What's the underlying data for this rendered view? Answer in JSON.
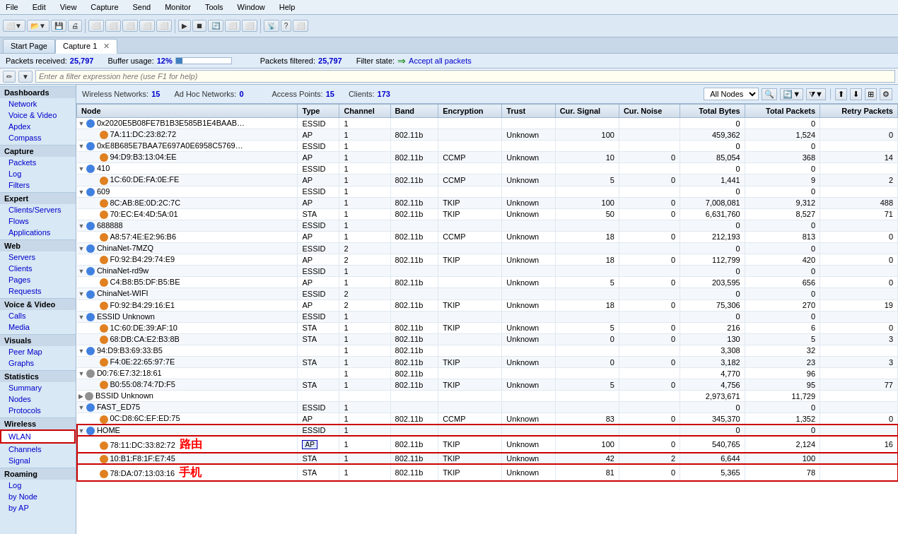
{
  "menubar": {
    "items": [
      "File",
      "Edit",
      "View",
      "Capture",
      "Send",
      "Monitor",
      "Tools",
      "Window",
      "Help"
    ]
  },
  "tabs": [
    {
      "label": "Start Page",
      "active": false
    },
    {
      "label": "Capture 1",
      "active": true,
      "closable": true
    }
  ],
  "statusbar": {
    "packets_received_label": "Packets received:",
    "packets_received_value": "25,797",
    "buffer_usage_label": "Buffer usage:",
    "buffer_usage_value": "12%",
    "packets_filtered_label": "Packets filtered:",
    "packets_filtered_value": "25,797",
    "filter_state_label": "Filter state:",
    "filter_state_value": "Accept all packets"
  },
  "filterbar": {
    "placeholder": "Enter a filter expression here (use F1 for help)"
  },
  "sidebar": {
    "sections": [
      {
        "label": "Dashboards",
        "items": [
          "Network",
          "Voice & Video",
          "Apdex",
          "Compass"
        ]
      },
      {
        "label": "Capture",
        "items": [
          "Packets",
          "Log",
          "Filters"
        ]
      },
      {
        "label": "Expert",
        "items": [
          "Clients/Servers",
          "Flows",
          "Applications"
        ]
      },
      {
        "label": "Web",
        "items": [
          "Servers",
          "Clients",
          "Pages",
          "Requests"
        ]
      },
      {
        "label": "Voice & Video",
        "items": [
          "Calls",
          "Media"
        ]
      },
      {
        "label": "Visuals",
        "items": [
          "Peer Map",
          "Graphs"
        ]
      },
      {
        "label": "Statistics",
        "items": [
          "Summary",
          "Nodes",
          "Protocols"
        ]
      },
      {
        "label": "Wireless",
        "items": [
          "WLAN",
          "Channels",
          "Signal"
        ]
      },
      {
        "label": "Roaming",
        "items": [
          "Log",
          "by Node",
          "by AP"
        ]
      }
    ]
  },
  "wireless_header": {
    "networks_label": "Wireless Networks:",
    "networks_value": "15",
    "access_points_label": "Access Points:",
    "access_points_value": "15",
    "adhoc_label": "Ad Hoc Networks:",
    "adhoc_value": "0",
    "clients_label": "Clients:",
    "clients_value": "173",
    "dropdown_value": "All Nodes"
  },
  "table": {
    "columns": [
      "Node",
      "Type",
      "Channel",
      "Band",
      "Encryption",
      "Trust",
      "Cur. Signal",
      "Cur. Noise",
      "Total Bytes",
      "Total Packets",
      "Retry Packets"
    ],
    "rows": [
      {
        "indent": 0,
        "expand": "expanded",
        "icon": "blue",
        "node": "0x2020E5B08FE7B1B3E585B1E4BAAB…",
        "type": "ESSID",
        "channel": "1",
        "band": "",
        "encryption": "",
        "trust": "",
        "cur_signal": "",
        "cur_noise": "",
        "total_bytes": "0",
        "total_packets": "0",
        "retry_packets": ""
      },
      {
        "indent": 1,
        "expand": "none",
        "icon": "orange",
        "node": "7A:11:DC:23:82:72",
        "type": "AP",
        "channel": "1",
        "band": "802.11b",
        "encryption": "",
        "trust": "Unknown",
        "cur_signal": "100",
        "cur_noise": "",
        "total_bytes": "459,362",
        "total_packets": "1,524",
        "retry_packets": "0"
      },
      {
        "indent": 0,
        "expand": "expanded",
        "icon": "blue",
        "node": "0xE8B685E7BAA7E697A0E6958C5769…",
        "type": "ESSID",
        "channel": "1",
        "band": "",
        "encryption": "",
        "trust": "",
        "cur_signal": "",
        "cur_noise": "",
        "total_bytes": "0",
        "total_packets": "0",
        "retry_packets": ""
      },
      {
        "indent": 1,
        "expand": "none",
        "icon": "orange",
        "node": "94:D9:B3:13:04:EE",
        "type": "AP",
        "channel": "1",
        "band": "802.11b",
        "encryption": "CCMP",
        "trust": "Unknown",
        "cur_signal": "10",
        "cur_noise": "0",
        "total_bytes": "85,054",
        "total_packets": "368",
        "retry_packets": "14"
      },
      {
        "indent": 0,
        "expand": "expanded",
        "icon": "blue",
        "node": "410",
        "type": "ESSID",
        "channel": "1",
        "band": "",
        "encryption": "",
        "trust": "",
        "cur_signal": "",
        "cur_noise": "",
        "total_bytes": "0",
        "total_packets": "0",
        "retry_packets": ""
      },
      {
        "indent": 1,
        "expand": "none",
        "icon": "orange",
        "node": "1C:60:DE:FA:0E:FE",
        "type": "AP",
        "channel": "1",
        "band": "802.11b",
        "encryption": "CCMP",
        "trust": "Unknown",
        "cur_signal": "5",
        "cur_noise": "0",
        "total_bytes": "1,441",
        "total_packets": "9",
        "retry_packets": "2"
      },
      {
        "indent": 0,
        "expand": "expanded",
        "icon": "blue",
        "node": "609",
        "type": "ESSID",
        "channel": "1",
        "band": "",
        "encryption": "",
        "trust": "",
        "cur_signal": "",
        "cur_noise": "",
        "total_bytes": "0",
        "total_packets": "0",
        "retry_packets": ""
      },
      {
        "indent": 1,
        "expand": "none",
        "icon": "orange",
        "node": "8C:AB:8E:0D:2C:7C",
        "type": "AP",
        "channel": "1",
        "band": "802.11b",
        "encryption": "TKIP",
        "trust": "Unknown",
        "cur_signal": "100",
        "cur_noise": "0",
        "total_bytes": "7,008,081",
        "total_packets": "9,312",
        "retry_packets": "488"
      },
      {
        "indent": 1,
        "expand": "none",
        "icon": "orange",
        "node": "70:EC:E4:4D:5A:01",
        "type": "STA",
        "channel": "1",
        "band": "802.11b",
        "encryption": "TKIP",
        "trust": "Unknown",
        "cur_signal": "50",
        "cur_noise": "0",
        "total_bytes": "6,631,760",
        "total_packets": "8,527",
        "retry_packets": "71"
      },
      {
        "indent": 0,
        "expand": "expanded",
        "icon": "blue",
        "node": "688888",
        "type": "ESSID",
        "channel": "1",
        "band": "",
        "encryption": "",
        "trust": "",
        "cur_signal": "",
        "cur_noise": "",
        "total_bytes": "0",
        "total_packets": "0",
        "retry_packets": ""
      },
      {
        "indent": 1,
        "expand": "none",
        "icon": "orange",
        "node": "A8:57:4E:E2:96:B6",
        "type": "AP",
        "channel": "1",
        "band": "802.11b",
        "encryption": "CCMP",
        "trust": "Unknown",
        "cur_signal": "18",
        "cur_noise": "0",
        "total_bytes": "212,193",
        "total_packets": "813",
        "retry_packets": "0"
      },
      {
        "indent": 0,
        "expand": "expanded",
        "icon": "blue",
        "node": "ChinaNet-7MZQ",
        "type": "ESSID",
        "channel": "2",
        "band": "",
        "encryption": "",
        "trust": "",
        "cur_signal": "",
        "cur_noise": "",
        "total_bytes": "0",
        "total_packets": "0",
        "retry_packets": ""
      },
      {
        "indent": 1,
        "expand": "none",
        "icon": "orange",
        "node": "F0:92:B4:29:74:E9",
        "type": "AP",
        "channel": "2",
        "band": "802.11b",
        "encryption": "TKIP",
        "trust": "Unknown",
        "cur_signal": "18",
        "cur_noise": "0",
        "total_bytes": "112,799",
        "total_packets": "420",
        "retry_packets": "0"
      },
      {
        "indent": 0,
        "expand": "expanded",
        "icon": "blue",
        "node": "ChinaNet-rd9w",
        "type": "ESSID",
        "channel": "1",
        "band": "",
        "encryption": "",
        "trust": "",
        "cur_signal": "",
        "cur_noise": "",
        "total_bytes": "0",
        "total_packets": "0",
        "retry_packets": ""
      },
      {
        "indent": 1,
        "expand": "none",
        "icon": "orange",
        "node": "C4:B8:B5:DF:B5:BE",
        "type": "AP",
        "channel": "1",
        "band": "802.11b",
        "encryption": "",
        "trust": "Unknown",
        "cur_signal": "5",
        "cur_noise": "0",
        "total_bytes": "203,595",
        "total_packets": "656",
        "retry_packets": "0"
      },
      {
        "indent": 0,
        "expand": "expanded",
        "icon": "blue",
        "node": "ChinaNet-WIFI",
        "type": "ESSID",
        "channel": "2",
        "band": "",
        "encryption": "",
        "trust": "",
        "cur_signal": "",
        "cur_noise": "",
        "total_bytes": "0",
        "total_packets": "0",
        "retry_packets": ""
      },
      {
        "indent": 1,
        "expand": "none",
        "icon": "orange",
        "node": "F0:92:B4:29:16:E1",
        "type": "AP",
        "channel": "2",
        "band": "802.11b",
        "encryption": "TKIP",
        "trust": "Unknown",
        "cur_signal": "18",
        "cur_noise": "0",
        "total_bytes": "75,306",
        "total_packets": "270",
        "retry_packets": "19"
      },
      {
        "indent": 0,
        "expand": "expanded",
        "icon": "blue",
        "node": "ESSID Unknown",
        "type": "ESSID",
        "channel": "1",
        "band": "",
        "encryption": "",
        "trust": "",
        "cur_signal": "",
        "cur_noise": "",
        "total_bytes": "0",
        "total_packets": "0",
        "retry_packets": ""
      },
      {
        "indent": 1,
        "expand": "none",
        "icon": "orange",
        "node": "1C:60:DE:39:AF:10",
        "type": "STA",
        "channel": "1",
        "band": "802.11b",
        "encryption": "TKIP",
        "trust": "Unknown",
        "cur_signal": "5",
        "cur_noise": "0",
        "total_bytes": "216",
        "total_packets": "6",
        "retry_packets": "0"
      },
      {
        "indent": 1,
        "expand": "none",
        "icon": "orange",
        "node": "68:DB:CA:E2:B3:8B",
        "type": "STA",
        "channel": "1",
        "band": "802.11b",
        "encryption": "",
        "trust": "Unknown",
        "cur_signal": "0",
        "cur_noise": "0",
        "total_bytes": "130",
        "total_packets": "5",
        "retry_packets": "3"
      },
      {
        "indent": 0,
        "expand": "expanded",
        "icon": "blue",
        "node": "94:D9:B3:69:33:B5",
        "type": "",
        "channel": "1",
        "band": "802.11b",
        "encryption": "",
        "trust": "",
        "cur_signal": "",
        "cur_noise": "",
        "total_bytes": "3,308",
        "total_packets": "32",
        "retry_packets": ""
      },
      {
        "indent": 1,
        "expand": "none",
        "icon": "orange",
        "node": "F4:0E:22:65:97:7E",
        "type": "STA",
        "channel": "1",
        "band": "802.11b",
        "encryption": "TKIP",
        "trust": "Unknown",
        "cur_signal": "0",
        "cur_noise": "0",
        "total_bytes": "3,182",
        "total_packets": "23",
        "retry_packets": "3"
      },
      {
        "indent": 0,
        "expand": "expanded",
        "icon": "gray",
        "node": "D0:76:E7:32:18:61",
        "type": "",
        "channel": "1",
        "band": "802.11b",
        "encryption": "",
        "trust": "",
        "cur_signal": "",
        "cur_noise": "",
        "total_bytes": "4,770",
        "total_packets": "96",
        "retry_packets": ""
      },
      {
        "indent": 1,
        "expand": "none",
        "icon": "orange",
        "node": "B0:55:08:74:7D:F5",
        "type": "STA",
        "channel": "1",
        "band": "802.11b",
        "encryption": "TKIP",
        "trust": "Unknown",
        "cur_signal": "5",
        "cur_noise": "0",
        "total_bytes": "4,756",
        "total_packets": "95",
        "retry_packets": "77"
      },
      {
        "indent": 0,
        "expand": "collapsed",
        "icon": "gray",
        "node": "BSSID Unknown",
        "type": "",
        "channel": "",
        "band": "",
        "encryption": "",
        "trust": "",
        "cur_signal": "",
        "cur_noise": "",
        "total_bytes": "2,973,671",
        "total_packets": "11,729",
        "retry_packets": ""
      },
      {
        "indent": 0,
        "expand": "expanded",
        "icon": "blue",
        "node": "FAST_ED75",
        "type": "ESSID",
        "channel": "1",
        "band": "",
        "encryption": "",
        "trust": "",
        "cur_signal": "",
        "cur_noise": "",
        "total_bytes": "0",
        "total_packets": "0",
        "retry_packets": ""
      },
      {
        "indent": 1,
        "expand": "none",
        "icon": "orange",
        "node": "0C:D8:6C:EF:ED:75",
        "type": "AP",
        "channel": "1",
        "band": "802.11b",
        "encryption": "CCMP",
        "trust": "Unknown",
        "cur_signal": "83",
        "cur_noise": "0",
        "total_bytes": "345,370",
        "total_packets": "1,352",
        "retry_packets": "0"
      },
      {
        "indent": 0,
        "expand": "expanded",
        "icon": "blue",
        "node": "HOME",
        "type": "ESSID",
        "channel": "1",
        "band": "",
        "encryption": "",
        "trust": "",
        "cur_signal": "",
        "cur_noise": "",
        "total_bytes": "0",
        "total_packets": "0",
        "retry_packets": "",
        "highlight": "red-border"
      },
      {
        "indent": 1,
        "expand": "none",
        "icon": "orange",
        "node": "78:11:DC:33:82:72",
        "type": "AP",
        "channel": "1",
        "band": "802.11b",
        "encryption": "TKIP",
        "trust": "Unknown",
        "cur_signal": "100",
        "cur_noise": "0",
        "total_bytes": "540,765",
        "total_packets": "2,124",
        "retry_packets": "16",
        "highlight": "red-border",
        "annotation": "路由"
      },
      {
        "indent": 1,
        "expand": "none",
        "icon": "orange",
        "node": "10:B1:F8:1F:E7:45",
        "type": "STA",
        "channel": "1",
        "band": "802.11b",
        "encryption": "TKIP",
        "trust": "Unknown",
        "cur_signal": "42",
        "cur_noise": "2",
        "total_bytes": "6,644",
        "total_packets": "100",
        "retry_packets": "",
        "highlight": "red-border"
      },
      {
        "indent": 1,
        "expand": "none",
        "icon": "orange",
        "node": "78:DA:07:13:03:16",
        "type": "STA",
        "channel": "1",
        "band": "802.11b",
        "encryption": "TKIP",
        "trust": "Unknown",
        "cur_signal": "81",
        "cur_noise": "0",
        "total_bytes": "5,365",
        "total_packets": "78",
        "retry_packets": "",
        "highlight": "red-border",
        "annotation": "手机"
      }
    ]
  },
  "annotations": {
    "router": "路由",
    "phone": "手机"
  }
}
